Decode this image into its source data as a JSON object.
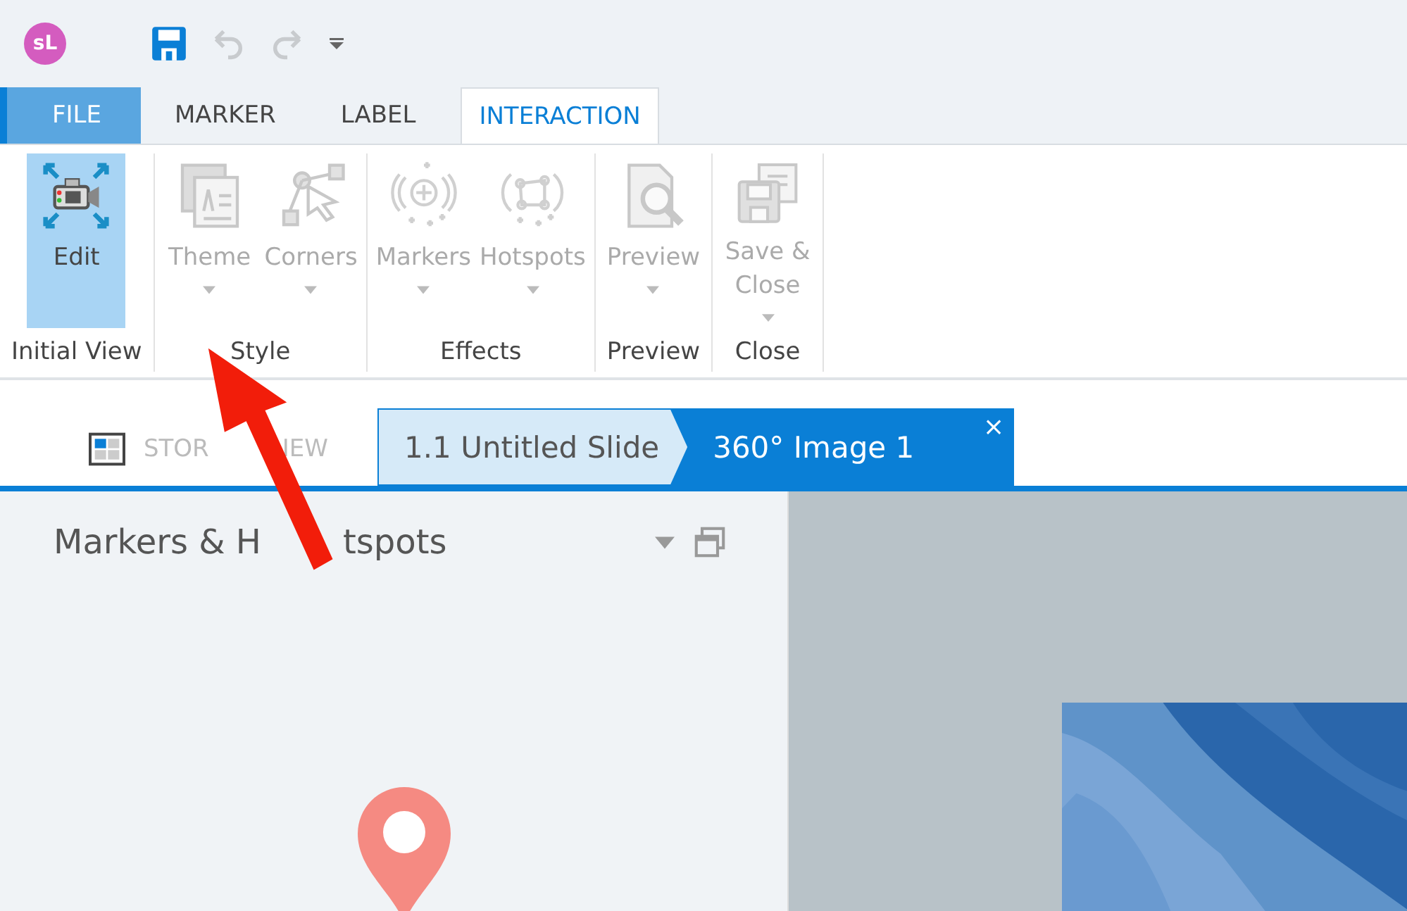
{
  "app": {
    "logo": "sL"
  },
  "tabs": [
    {
      "label": "FILE",
      "kind": "file",
      "selected": false
    },
    {
      "label": "MARKER",
      "kind": "tab",
      "selected": false
    },
    {
      "label": "LABEL",
      "kind": "tab",
      "selected": false
    },
    {
      "label": "INTERACTION",
      "kind": "tab",
      "selected": true
    }
  ],
  "ribbon": {
    "groups": [
      {
        "label": "Initial View",
        "buttons": [
          {
            "label": "Edit",
            "kind": "camera",
            "selected": true,
            "disabled": false,
            "menu": false
          }
        ]
      },
      {
        "label": "Style",
        "buttons": [
          {
            "label": "Theme",
            "kind": "theme",
            "selected": false,
            "disabled": true,
            "menu": true
          },
          {
            "label": "Corners",
            "kind": "corners",
            "selected": false,
            "disabled": true,
            "menu": true
          }
        ]
      },
      {
        "label": "Effects",
        "buttons": [
          {
            "label": "Markers",
            "kind": "markers",
            "selected": false,
            "disabled": true,
            "menu": true
          },
          {
            "label": "Hotspots",
            "kind": "hotspots",
            "selected": false,
            "disabled": true,
            "menu": true
          }
        ]
      },
      {
        "label": "Preview",
        "buttons": [
          {
            "label": "Preview",
            "kind": "preview",
            "selected": false,
            "disabled": true,
            "menu": true
          }
        ]
      },
      {
        "label": "Close",
        "buttons": [
          {
            "label": "Save &\nClose",
            "kind": "save",
            "selected": false,
            "disabled": true,
            "menu": true
          }
        ]
      }
    ]
  },
  "story_view": {
    "label_parts": [
      "STOR",
      "IEW"
    ]
  },
  "breadcrumb": [
    {
      "label": "1.1 Untitled Slide",
      "selected": false
    },
    {
      "label": "360° Image 1",
      "selected": true
    }
  ],
  "close_tab": "×",
  "panel": {
    "title_parts": [
      "Markers & H",
      "tspots"
    ]
  }
}
